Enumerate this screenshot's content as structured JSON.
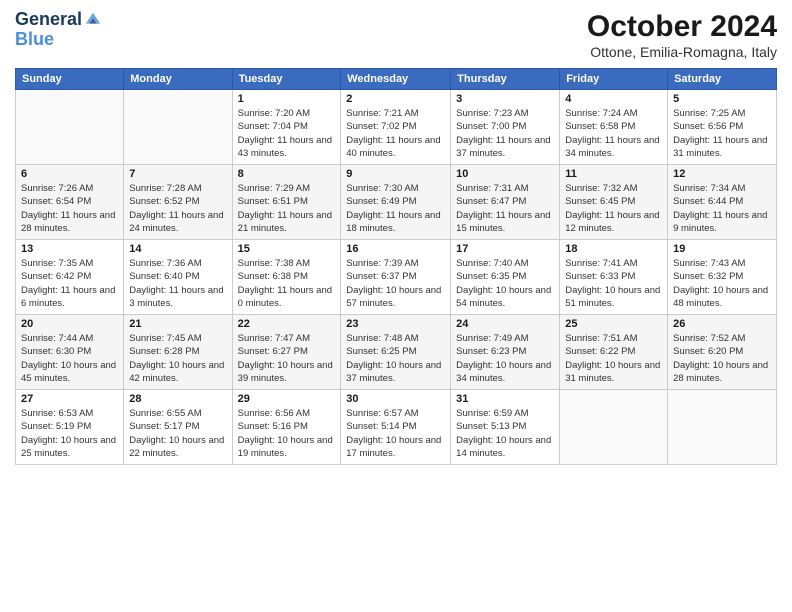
{
  "logo": {
    "line1": "General",
    "line2": "Blue"
  },
  "title": "October 2024",
  "subtitle": "Ottone, Emilia-Romagna, Italy",
  "weekdays": [
    "Sunday",
    "Monday",
    "Tuesday",
    "Wednesday",
    "Thursday",
    "Friday",
    "Saturday"
  ],
  "weeks": [
    [
      {
        "day": "",
        "info": ""
      },
      {
        "day": "",
        "info": ""
      },
      {
        "day": "1",
        "info": "Sunrise: 7:20 AM\nSunset: 7:04 PM\nDaylight: 11 hours and 43 minutes."
      },
      {
        "day": "2",
        "info": "Sunrise: 7:21 AM\nSunset: 7:02 PM\nDaylight: 11 hours and 40 minutes."
      },
      {
        "day": "3",
        "info": "Sunrise: 7:23 AM\nSunset: 7:00 PM\nDaylight: 11 hours and 37 minutes."
      },
      {
        "day": "4",
        "info": "Sunrise: 7:24 AM\nSunset: 6:58 PM\nDaylight: 11 hours and 34 minutes."
      },
      {
        "day": "5",
        "info": "Sunrise: 7:25 AM\nSunset: 6:56 PM\nDaylight: 11 hours and 31 minutes."
      }
    ],
    [
      {
        "day": "6",
        "info": "Sunrise: 7:26 AM\nSunset: 6:54 PM\nDaylight: 11 hours and 28 minutes."
      },
      {
        "day": "7",
        "info": "Sunrise: 7:28 AM\nSunset: 6:52 PM\nDaylight: 11 hours and 24 minutes."
      },
      {
        "day": "8",
        "info": "Sunrise: 7:29 AM\nSunset: 6:51 PM\nDaylight: 11 hours and 21 minutes."
      },
      {
        "day": "9",
        "info": "Sunrise: 7:30 AM\nSunset: 6:49 PM\nDaylight: 11 hours and 18 minutes."
      },
      {
        "day": "10",
        "info": "Sunrise: 7:31 AM\nSunset: 6:47 PM\nDaylight: 11 hours and 15 minutes."
      },
      {
        "day": "11",
        "info": "Sunrise: 7:32 AM\nSunset: 6:45 PM\nDaylight: 11 hours and 12 minutes."
      },
      {
        "day": "12",
        "info": "Sunrise: 7:34 AM\nSunset: 6:44 PM\nDaylight: 11 hours and 9 minutes."
      }
    ],
    [
      {
        "day": "13",
        "info": "Sunrise: 7:35 AM\nSunset: 6:42 PM\nDaylight: 11 hours and 6 minutes."
      },
      {
        "day": "14",
        "info": "Sunrise: 7:36 AM\nSunset: 6:40 PM\nDaylight: 11 hours and 3 minutes."
      },
      {
        "day": "15",
        "info": "Sunrise: 7:38 AM\nSunset: 6:38 PM\nDaylight: 11 hours and 0 minutes."
      },
      {
        "day": "16",
        "info": "Sunrise: 7:39 AM\nSunset: 6:37 PM\nDaylight: 10 hours and 57 minutes."
      },
      {
        "day": "17",
        "info": "Sunrise: 7:40 AM\nSunset: 6:35 PM\nDaylight: 10 hours and 54 minutes."
      },
      {
        "day": "18",
        "info": "Sunrise: 7:41 AM\nSunset: 6:33 PM\nDaylight: 10 hours and 51 minutes."
      },
      {
        "day": "19",
        "info": "Sunrise: 7:43 AM\nSunset: 6:32 PM\nDaylight: 10 hours and 48 minutes."
      }
    ],
    [
      {
        "day": "20",
        "info": "Sunrise: 7:44 AM\nSunset: 6:30 PM\nDaylight: 10 hours and 45 minutes."
      },
      {
        "day": "21",
        "info": "Sunrise: 7:45 AM\nSunset: 6:28 PM\nDaylight: 10 hours and 42 minutes."
      },
      {
        "day": "22",
        "info": "Sunrise: 7:47 AM\nSunset: 6:27 PM\nDaylight: 10 hours and 39 minutes."
      },
      {
        "day": "23",
        "info": "Sunrise: 7:48 AM\nSunset: 6:25 PM\nDaylight: 10 hours and 37 minutes."
      },
      {
        "day": "24",
        "info": "Sunrise: 7:49 AM\nSunset: 6:23 PM\nDaylight: 10 hours and 34 minutes."
      },
      {
        "day": "25",
        "info": "Sunrise: 7:51 AM\nSunset: 6:22 PM\nDaylight: 10 hours and 31 minutes."
      },
      {
        "day": "26",
        "info": "Sunrise: 7:52 AM\nSunset: 6:20 PM\nDaylight: 10 hours and 28 minutes."
      }
    ],
    [
      {
        "day": "27",
        "info": "Sunrise: 6:53 AM\nSunset: 5:19 PM\nDaylight: 10 hours and 25 minutes."
      },
      {
        "day": "28",
        "info": "Sunrise: 6:55 AM\nSunset: 5:17 PM\nDaylight: 10 hours and 22 minutes."
      },
      {
        "day": "29",
        "info": "Sunrise: 6:56 AM\nSunset: 5:16 PM\nDaylight: 10 hours and 19 minutes."
      },
      {
        "day": "30",
        "info": "Sunrise: 6:57 AM\nSunset: 5:14 PM\nDaylight: 10 hours and 17 minutes."
      },
      {
        "day": "31",
        "info": "Sunrise: 6:59 AM\nSunset: 5:13 PM\nDaylight: 10 hours and 14 minutes."
      },
      {
        "day": "",
        "info": ""
      },
      {
        "day": "",
        "info": ""
      }
    ]
  ]
}
